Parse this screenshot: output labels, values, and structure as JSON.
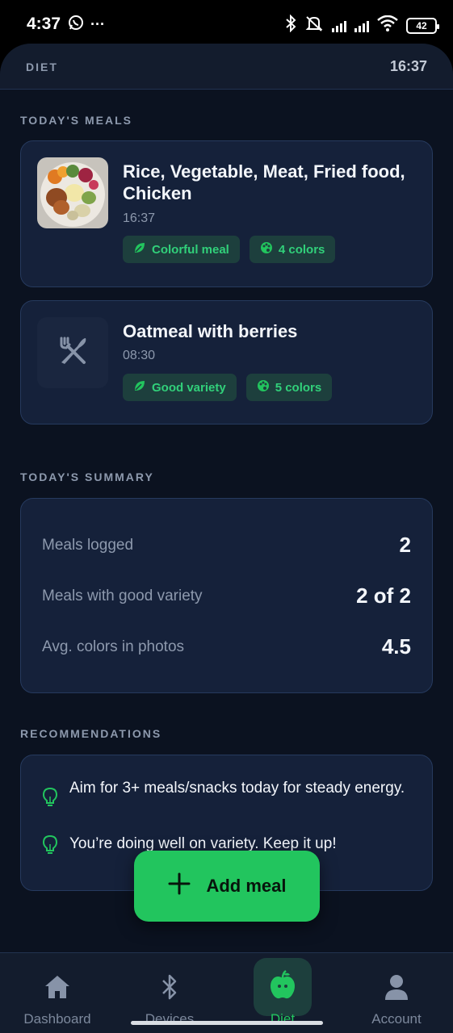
{
  "status_bar": {
    "time": "4:37",
    "battery": "42"
  },
  "header": {
    "title": "DIET",
    "time": "16:37"
  },
  "meals_section": {
    "label": "TODAY'S MEALS"
  },
  "meals": [
    {
      "name": "Rice, Vegetable, Meat, Fried food, Chicken",
      "time": "16:37",
      "tags": [
        "Colorful meal",
        "4 colors"
      ]
    },
    {
      "name": "Oatmeal with berries",
      "time": "08:30",
      "tags": [
        "Good variety",
        "5 colors"
      ]
    }
  ],
  "summary_section": {
    "label": "TODAY'S SUMMARY"
  },
  "summary": [
    {
      "label": "Meals logged",
      "value": "2"
    },
    {
      "label": "Meals with good variety",
      "value": "2 of 2"
    },
    {
      "label": "Avg. colors in photos",
      "value": "4.5"
    }
  ],
  "recommendations_section": {
    "label": "RECOMMENDATIONS"
  },
  "recommendations": [
    "Aim for 3+ meals/snacks today for steady energy.",
    "You’re doing well on variety. Keep it up!"
  ],
  "fab": {
    "label": "Add meal"
  },
  "nav": [
    {
      "label": "Dashboard",
      "icon": "home-icon",
      "active": false
    },
    {
      "label": "Devices",
      "icon": "bluetooth-icon",
      "active": false
    },
    {
      "label": "Diet",
      "icon": "apple-icon",
      "active": true
    },
    {
      "label": "Account",
      "icon": "person-icon",
      "active": false
    }
  ],
  "colors": {
    "accent": "#22c55e",
    "background": "#0b1220",
    "card": "#15213a",
    "tag_bg": "#1d3f3d"
  }
}
